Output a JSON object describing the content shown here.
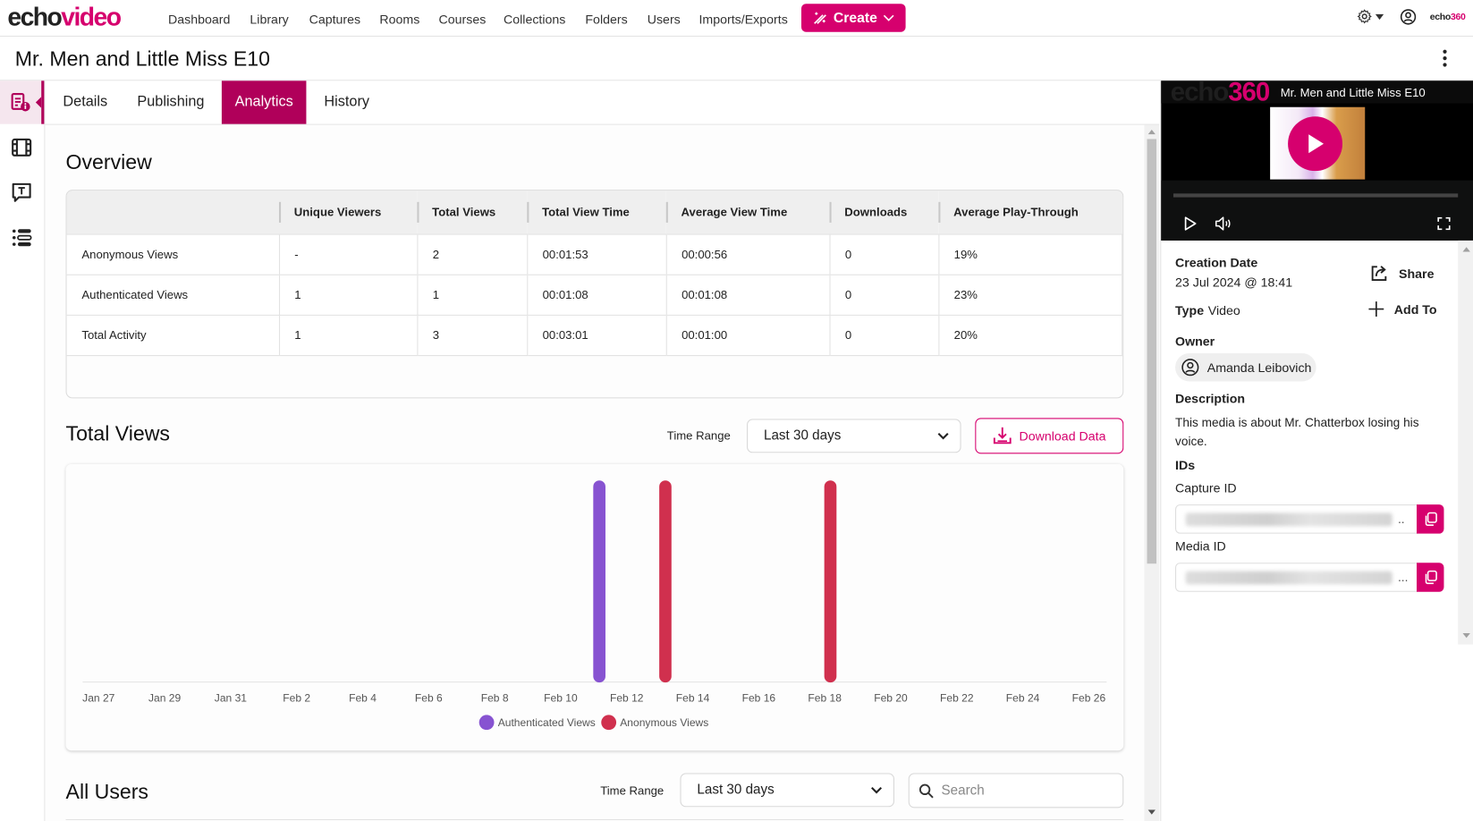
{
  "app": {
    "logo_left": "echo",
    "logo_right": "video",
    "brand_small_left": "echo",
    "brand_small_right": "360"
  },
  "nav": {
    "items": [
      "Dashboard",
      "Library",
      "Captures",
      "Rooms",
      "Courses",
      "Collections",
      "Folders",
      "Users",
      "Imports/Exports"
    ],
    "create_label": "Create"
  },
  "page": {
    "title": "Mr. Men and Little Miss E10"
  },
  "rail": {
    "items": [
      "details",
      "media",
      "captions",
      "chapters"
    ]
  },
  "tabs": [
    {
      "label": "Details",
      "active": false
    },
    {
      "label": "Publishing",
      "active": false
    },
    {
      "label": "Analytics",
      "active": true
    },
    {
      "label": "History",
      "active": false
    }
  ],
  "overview": {
    "title": "Overview",
    "columns": [
      "",
      "Unique Viewers",
      "Total Views",
      "Total View Time",
      "Average View Time",
      "Downloads",
      "Average Play-Through"
    ],
    "rows": [
      [
        "Anonymous Views",
        "-",
        "2",
        "00:01:53",
        "00:00:56",
        "0",
        "19%"
      ],
      [
        "Authenticated Views",
        "1",
        "1",
        "00:01:08",
        "00:01:08",
        "0",
        "23%"
      ],
      [
        "Total Activity",
        "1",
        "3",
        "00:03:01",
        "00:01:00",
        "0",
        "20%"
      ]
    ]
  },
  "total_views": {
    "title": "Total Views",
    "time_range_label": "Time Range",
    "time_range_value": "Last 30 days",
    "download_label": "Download Data"
  },
  "chart_data": {
    "type": "bar",
    "title": "Total Views",
    "xlabel": "",
    "ylabel": "",
    "x_ticks": [
      "Jan 27",
      "Jan 29",
      "Jan 31",
      "Feb 2",
      "Feb 4",
      "Feb 6",
      "Feb 8",
      "Feb 10",
      "Feb 12",
      "Feb 14",
      "Feb 16",
      "Feb 18",
      "Feb 20",
      "Feb 22",
      "Feb 24",
      "Feb 26"
    ],
    "x_range": [
      "Jan 27",
      "Feb 26"
    ],
    "ylim": [
      0,
      1
    ],
    "grid": false,
    "legend_position": "bottom-center",
    "series": [
      {
        "name": "Authenticated Views",
        "color": "#8753d1",
        "points": [
          {
            "x": "Feb 11",
            "y": 1
          }
        ]
      },
      {
        "name": "Anonymous Views",
        "color": "#d0304e",
        "points": [
          {
            "x": "Feb 13",
            "y": 1
          },
          {
            "x": "Feb 18",
            "y": 1
          }
        ]
      }
    ]
  },
  "all_users": {
    "title": "All Users",
    "time_range_label": "Time Range",
    "time_range_value": "Last 30 days",
    "search_placeholder": "Search"
  },
  "player": {
    "title": "Mr. Men and Little Miss E10",
    "brand_left": "echo",
    "brand_right": "360"
  },
  "details": {
    "creation_date_label": "Creation Date",
    "creation_date": "23 Jul 2024 @ 18:41",
    "type_label": "Type",
    "type_value": "Video",
    "share_label": "Share",
    "add_to_label": "Add To",
    "owner_label": "Owner",
    "owner_name": "Amanda Leibovich",
    "description_label": "Description",
    "description": "This media is about Mr. Chatterbox losing his voice.",
    "ids_label": "IDs",
    "capture_id_label": "Capture ID",
    "media_id_label": "Media ID",
    "capture_id_suffix": "..",
    "media_id_suffix": "..."
  },
  "colors": {
    "accent": "#d6006e",
    "tab_active": "#b0005a",
    "authenticated": "#8753d1",
    "anonymous": "#d0304e"
  }
}
